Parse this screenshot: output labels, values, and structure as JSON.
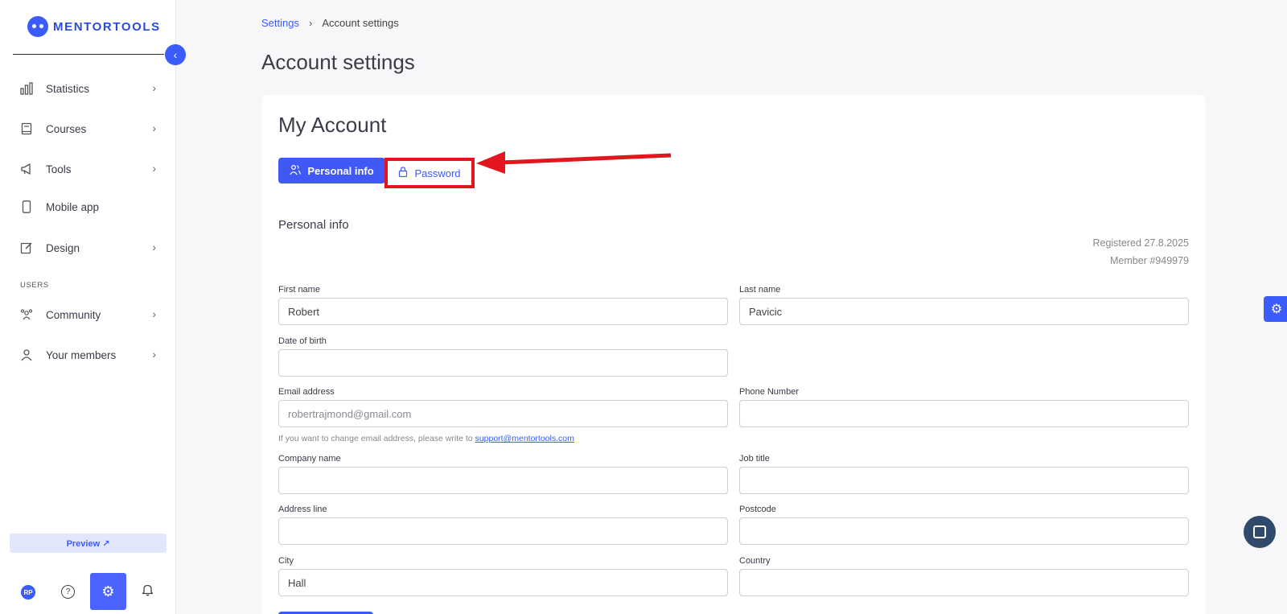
{
  "brand": {
    "name": "MENTORTOOLS"
  },
  "sidebar": {
    "items": [
      {
        "label": "Statistics",
        "icon": "bar-chart-icon",
        "has_chevron": true
      },
      {
        "label": "Courses",
        "icon": "book-icon",
        "has_chevron": true
      },
      {
        "label": "Tools",
        "icon": "megaphone-icon",
        "has_chevron": true
      },
      {
        "label": "Mobile app",
        "icon": "phone-icon",
        "has_chevron": false
      },
      {
        "label": "Design",
        "icon": "pencil-icon",
        "has_chevron": true
      },
      {
        "label": "Community",
        "icon": "group-icon",
        "has_chevron": true
      },
      {
        "label": "Your members",
        "icon": "user-icon",
        "has_chevron": true
      }
    ],
    "section_users": "USERS",
    "preview_label": "Preview ↗",
    "avatar_initials": "RP"
  },
  "breadcrumb": {
    "parent": "Settings",
    "current": "Account settings"
  },
  "page_title": "Account settings",
  "card": {
    "title": "My Account",
    "tabs": {
      "personal": "Personal info",
      "password": "Password"
    },
    "section_title": "Personal info",
    "registered": "Registered 27.8.2025",
    "member": "Member #949979",
    "fields": {
      "first_name": {
        "label": "First name",
        "value": "Robert"
      },
      "last_name": {
        "label": "Last name",
        "value": "Pavicic"
      },
      "dob": {
        "label": "Date of birth",
        "value": ""
      },
      "email": {
        "label": "Email address",
        "value": "robertrajmond@gmail.com"
      },
      "phone": {
        "label": "Phone Number",
        "value": ""
      },
      "company": {
        "label": "Company name",
        "value": ""
      },
      "job": {
        "label": "Job title",
        "value": ""
      },
      "address": {
        "label": "Address line",
        "value": ""
      },
      "postcode": {
        "label": "Postcode",
        "value": ""
      },
      "city": {
        "label": "City",
        "value": "Hall"
      },
      "country": {
        "label": "Country",
        "value": ""
      }
    },
    "email_helper": "If you want to change email address, please write to",
    "support_email": "support@mentortools.com"
  },
  "colors": {
    "accent": "#3b5bfd",
    "highlight": "#e3161f"
  }
}
